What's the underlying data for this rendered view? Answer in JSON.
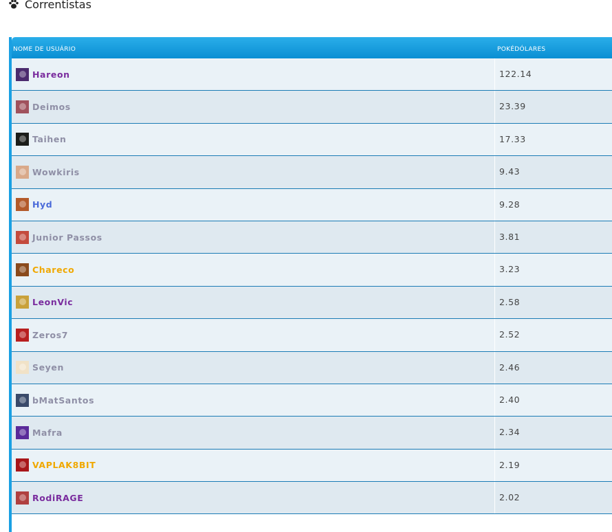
{
  "page": {
    "title": "Correntistas",
    "title_icon": "paw-icon"
  },
  "table": {
    "col_user": "NOME DE USUÁRIO",
    "col_value": "POKÉDÓLARES",
    "rows": [
      {
        "name": "Hareon",
        "value": "122.14",
        "color": "#7a2c9e",
        "avatar": "#4b2b6e"
      },
      {
        "name": "Deimos",
        "value": "23.39",
        "color": "#8f8fa6",
        "avatar": "#a0525d"
      },
      {
        "name": "Taihen",
        "value": "17.33",
        "color": "#8f8fa6",
        "avatar": "#1b1d1a"
      },
      {
        "name": "Wowkiris",
        "value": "9.43",
        "color": "#8f8fa6",
        "avatar": "#d9a98a"
      },
      {
        "name": "Hyd",
        "value": "9.28",
        "color": "#4a6ad9",
        "avatar": "#b35a2a"
      },
      {
        "name": "Junior Passos",
        "value": "3.81",
        "color": "#8f8fa6",
        "avatar": "#c44b3d"
      },
      {
        "name": "Chareco",
        "value": "3.23",
        "color": "#f0a800",
        "avatar": "#8a4a1c"
      },
      {
        "name": "LeonVic",
        "value": "2.58",
        "color": "#7a2c9e",
        "avatar": "#c9a13a"
      },
      {
        "name": "Zeros7",
        "value": "2.52",
        "color": "#8f8fa6",
        "avatar": "#b81f1f"
      },
      {
        "name": "Seyen",
        "value": "2.46",
        "color": "#8f8fa6",
        "avatar": "#f1e2c7"
      },
      {
        "name": "bMatSantos",
        "value": "2.40",
        "color": "#8f8fa6",
        "avatar": "#3a4a6a"
      },
      {
        "name": "Mafra",
        "value": "2.34",
        "color": "#8f8fa6",
        "avatar": "#5a2a9a"
      },
      {
        "name": "VAPLAK8BIT",
        "value": "2.19",
        "color": "#f0a800",
        "avatar": "#a8161a"
      },
      {
        "name": "RodiRAGE",
        "value": "2.02",
        "color": "#7a2c9e",
        "avatar": "#b04040"
      }
    ]
  }
}
